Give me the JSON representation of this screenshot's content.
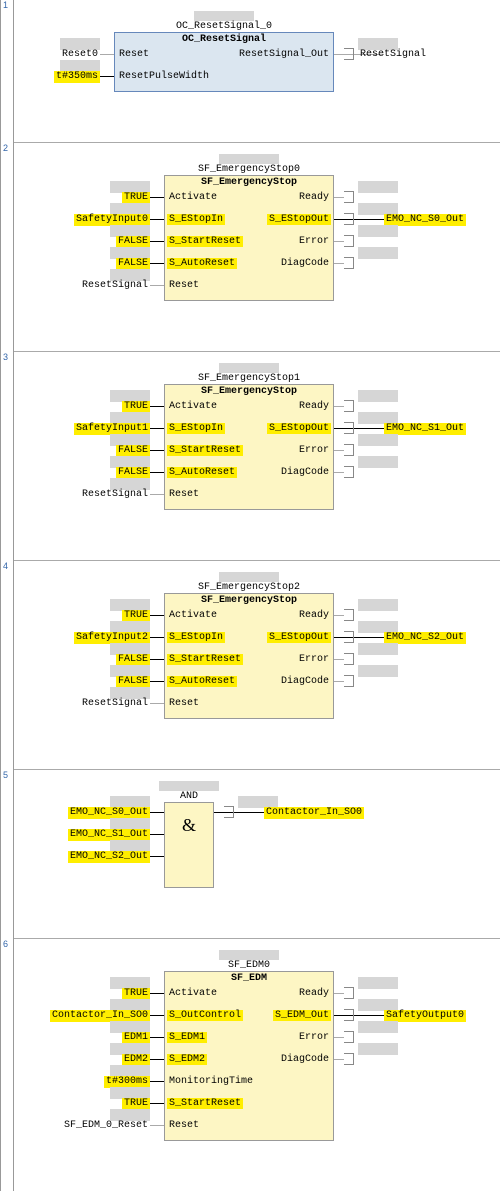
{
  "networks": [
    {
      "num": "1",
      "block": {
        "instance": "OC_ResetSignal_0",
        "type": "OC_ResetSignal",
        "style": "blue",
        "inputs": [
          {
            "name": "Reset",
            "ext": "Reset0",
            "safety": false,
            "extSafety": false
          },
          {
            "name": "ResetPulseWidth",
            "ext": "t#350ms",
            "safety": false,
            "extSafety": true
          }
        ],
        "outputs": [
          {
            "name": "ResetSignal_Out",
            "ext": "ResetSignal",
            "safety": false,
            "extSafety": false
          }
        ]
      }
    },
    {
      "num": "2",
      "block": {
        "instance": "SF_EmergencyStop0",
        "type": "SF_EmergencyStop",
        "style": "yellow",
        "inputs": [
          {
            "name": "Activate",
            "ext": "TRUE",
            "safety": false,
            "extSafety": true
          },
          {
            "name": "S_EStopIn",
            "ext": "SafetyInput0",
            "safety": true,
            "extSafety": true
          },
          {
            "name": "S_StartReset",
            "ext": "FALSE",
            "safety": true,
            "extSafety": true
          },
          {
            "name": "S_AutoReset",
            "ext": "FALSE",
            "safety": true,
            "extSafety": true
          },
          {
            "name": "Reset",
            "ext": "ResetSignal",
            "safety": false,
            "extSafety": false
          }
        ],
        "outputs": [
          {
            "name": "Ready",
            "ext": "",
            "safety": false,
            "extSafety": false
          },
          {
            "name": "S_EStopOut",
            "ext": "EMO_NC_S0_Out",
            "safety": true,
            "extSafety": true
          },
          {
            "name": "Error",
            "ext": "",
            "safety": false,
            "extSafety": false
          },
          {
            "name": "DiagCode",
            "ext": "",
            "safety": false,
            "extSafety": false
          }
        ]
      }
    },
    {
      "num": "3",
      "block": {
        "instance": "SF_EmergencyStop1",
        "type": "SF_EmergencyStop",
        "style": "yellow",
        "inputs": [
          {
            "name": "Activate",
            "ext": "TRUE",
            "safety": false,
            "extSafety": true
          },
          {
            "name": "S_EStopIn",
            "ext": "SafetyInput1",
            "safety": true,
            "extSafety": true
          },
          {
            "name": "S_StartReset",
            "ext": "FALSE",
            "safety": true,
            "extSafety": true
          },
          {
            "name": "S_AutoReset",
            "ext": "FALSE",
            "safety": true,
            "extSafety": true
          },
          {
            "name": "Reset",
            "ext": "ResetSignal",
            "safety": false,
            "extSafety": false
          }
        ],
        "outputs": [
          {
            "name": "Ready",
            "ext": "",
            "safety": false,
            "extSafety": false
          },
          {
            "name": "S_EStopOut",
            "ext": "EMO_NC_S1_Out",
            "safety": true,
            "extSafety": true
          },
          {
            "name": "Error",
            "ext": "",
            "safety": false,
            "extSafety": false
          },
          {
            "name": "DiagCode",
            "ext": "",
            "safety": false,
            "extSafety": false
          }
        ]
      }
    },
    {
      "num": "4",
      "block": {
        "instance": "SF_EmergencyStop2",
        "type": "SF_EmergencyStop",
        "style": "yellow",
        "inputs": [
          {
            "name": "Activate",
            "ext": "TRUE",
            "safety": false,
            "extSafety": true
          },
          {
            "name": "S_EStopIn",
            "ext": "SafetyInput2",
            "safety": true,
            "extSafety": true
          },
          {
            "name": "S_StartReset",
            "ext": "FALSE",
            "safety": true,
            "extSafety": true
          },
          {
            "name": "S_AutoReset",
            "ext": "FALSE",
            "safety": true,
            "extSafety": true
          },
          {
            "name": "Reset",
            "ext": "ResetSignal",
            "safety": false,
            "extSafety": false
          }
        ],
        "outputs": [
          {
            "name": "Ready",
            "ext": "",
            "safety": false,
            "extSafety": false
          },
          {
            "name": "S_EStopOut",
            "ext": "EMO_NC_S2_Out",
            "safety": true,
            "extSafety": true
          },
          {
            "name": "Error",
            "ext": "",
            "safety": false,
            "extSafety": false
          },
          {
            "name": "DiagCode",
            "ext": "",
            "safety": false,
            "extSafety": false
          }
        ]
      }
    },
    {
      "num": "5",
      "block": {
        "instance": "AND",
        "type": "&",
        "style": "yellow",
        "amp": true,
        "inputs": [
          {
            "name": "",
            "ext": "EMO_NC_S0_Out",
            "safety": false,
            "extSafety": true
          },
          {
            "name": "",
            "ext": "EMO_NC_S1_Out",
            "safety": false,
            "extSafety": true
          },
          {
            "name": "",
            "ext": "EMO_NC_S2_Out",
            "safety": false,
            "extSafety": true
          }
        ],
        "outputs": [
          {
            "name": "",
            "ext": "Contactor_In_SO0",
            "safety": false,
            "extSafety": true
          }
        ]
      }
    },
    {
      "num": "6",
      "block": {
        "instance": "SF_EDM0",
        "type": "SF_EDM",
        "style": "yellow",
        "inputs": [
          {
            "name": "Activate",
            "ext": "TRUE",
            "safety": false,
            "extSafety": true
          },
          {
            "name": "S_OutControl",
            "ext": "Contactor_In_SO0",
            "safety": true,
            "extSafety": true
          },
          {
            "name": "S_EDM1",
            "ext": "EDM1",
            "safety": true,
            "extSafety": true
          },
          {
            "name": "S_EDM2",
            "ext": "EDM2",
            "safety": true,
            "extSafety": true
          },
          {
            "name": "MonitoringTime",
            "ext": "t#300ms",
            "safety": false,
            "extSafety": true
          },
          {
            "name": "S_StartReset",
            "ext": "TRUE",
            "safety": true,
            "extSafety": true
          },
          {
            "name": "Reset",
            "ext": "SF_EDM_0_Reset",
            "safety": false,
            "extSafety": false
          }
        ],
        "outputs": [
          {
            "name": "Ready",
            "ext": "",
            "safety": false,
            "extSafety": false
          },
          {
            "name": "S_EDM_Out",
            "ext": "SafetyOutput0",
            "safety": true,
            "extSafety": true
          },
          {
            "name": "Error",
            "ext": "",
            "safety": false,
            "extSafety": false
          },
          {
            "name": "DiagCode",
            "ext": "",
            "safety": false,
            "extSafety": false
          }
        ]
      }
    }
  ],
  "layout": {
    "blockLeft": 150,
    "blockWidth": 170,
    "andBlockLeft": 150,
    "andBlockWidth": 50,
    "blueBlockLeft": 100,
    "blueBlockWidth": 220
  }
}
